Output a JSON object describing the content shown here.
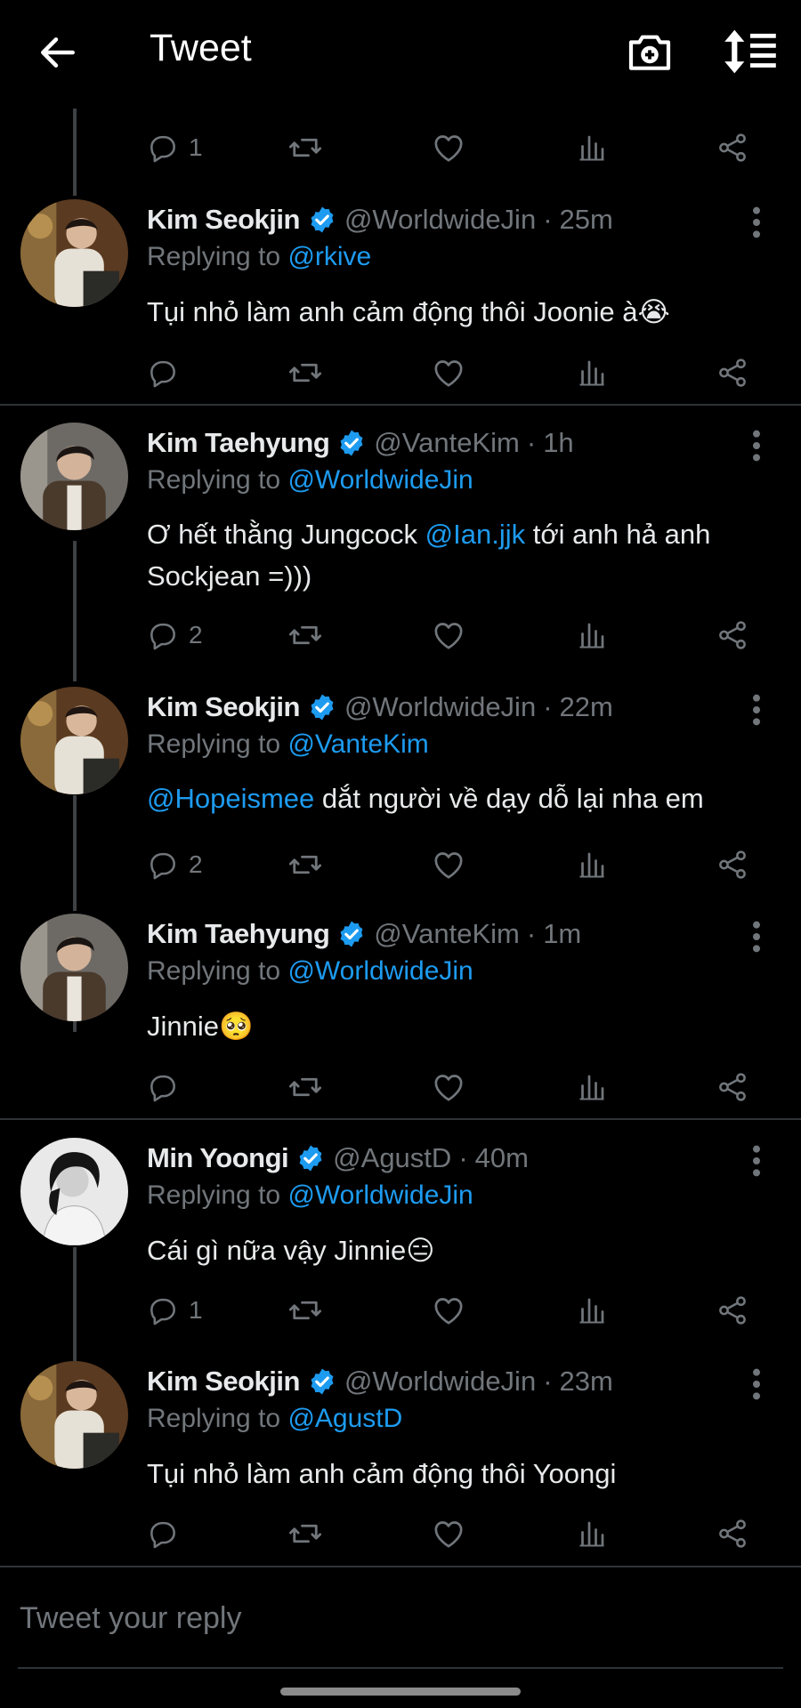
{
  "header": {
    "title": "Tweet",
    "back_icon": "arrow-left-icon",
    "camera_icon": "camera-plus-icon",
    "sort_icon": "sort-list-icon"
  },
  "colors": {
    "background": "#000000",
    "accent": "#1d9bf0",
    "muted": "#71767b",
    "text": "#e7e9ea",
    "divider": "#2f3336"
  },
  "top_actions": {
    "reply_count": "1"
  },
  "tweets": [
    {
      "name": "Kim Seokjin",
      "handle": "@WorldwideJin",
      "sep": "·",
      "time": "25m",
      "replying_label": "Replying to",
      "replying_to": "@rkive",
      "text": "Tụi nhỏ làm anh cảm động thôi Joonie à",
      "emoji": "😭",
      "reply_count": ""
    },
    {
      "name": "Kim Taehyung",
      "handle": "@VanteKim",
      "sep": "·",
      "time": "1h",
      "replying_label": "Replying to",
      "replying_to": "@WorldwideJin",
      "text_before": "Ơ hết thằng Jungcock ",
      "mention": "@Ian.jjk",
      "text_after": " tới anh hả anh Sockjean =)))",
      "reply_count": "2"
    },
    {
      "name": "Kim Seokjin",
      "handle": "@WorldwideJin",
      "sep": "·",
      "time": "22m",
      "replying_label": "Replying to",
      "replying_to": "@VanteKim",
      "mention": "@Hopeismee",
      "text_after": " dắt người về dạy dỗ lại nha em",
      "reply_count": "2"
    },
    {
      "name": "Kim Taehyung",
      "handle": "@VanteKim",
      "sep": "·",
      "time": "1m",
      "replying_label": "Replying to",
      "replying_to": "@WorldwideJin",
      "text": "Jinnie",
      "emoji": "🥺",
      "reply_count": ""
    },
    {
      "name": "Min Yoongi",
      "handle": "@AgustD",
      "sep": "·",
      "time": "40m",
      "replying_label": "Replying to",
      "replying_to": "@WorldwideJin",
      "text": "Cái gì nữa vậy Jinnie",
      "emoji": "😑",
      "reply_count": "1"
    },
    {
      "name": "Kim Seokjin",
      "handle": "@WorldwideJin",
      "sep": "·",
      "time": "23m",
      "replying_label": "Replying to",
      "replying_to": "@AgustD",
      "text": "Tụi nhỏ làm anh cảm động thôi Yoongi",
      "reply_count": ""
    }
  ],
  "composer": {
    "placeholder": "Tweet your reply"
  }
}
